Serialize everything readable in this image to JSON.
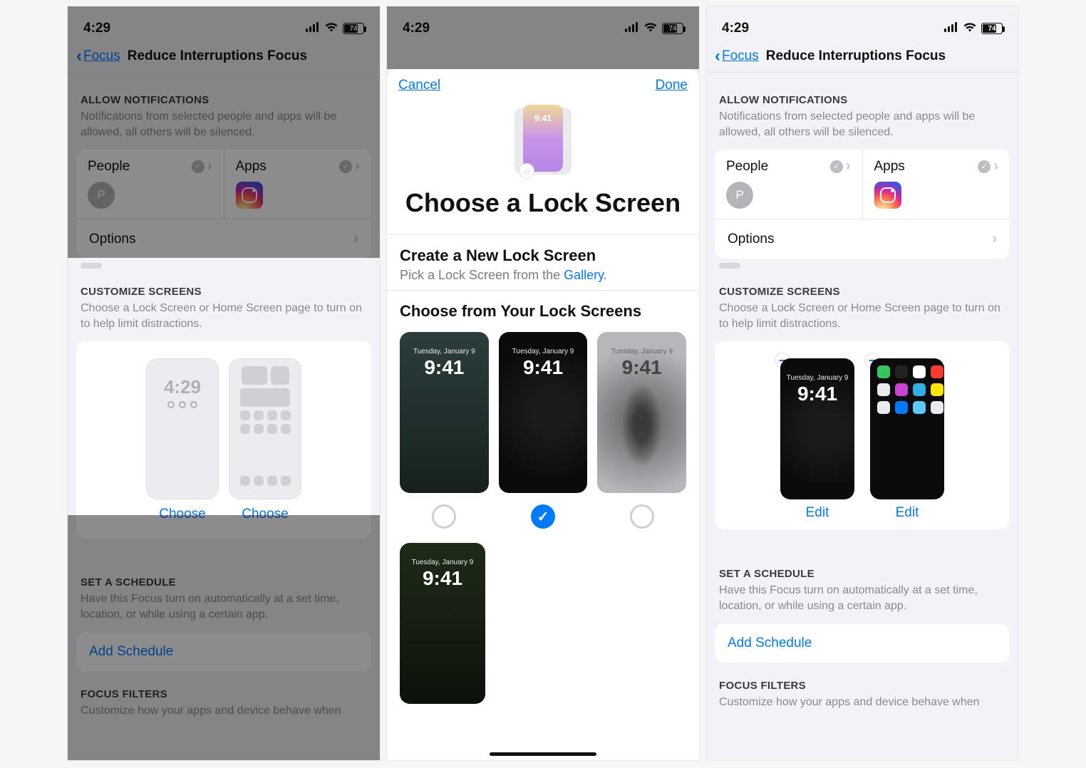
{
  "status": {
    "time": "4:29",
    "battery": "74",
    "batteryFill": "74%"
  },
  "nav": {
    "back": "Focus",
    "title": "Reduce Interruptions Focus"
  },
  "allow": {
    "header": "ALLOW NOTIFICATIONS",
    "sub": "Notifications from selected people and apps will be allowed, all others will be silenced.",
    "people": "People",
    "apps": "Apps",
    "peopleInitial": "P",
    "options": "Options"
  },
  "customize": {
    "header": "CUSTOMIZE SCREENS",
    "sub": "Choose a Lock Screen or Home Screen page to turn on to help limit distractions.",
    "choose": "Choose",
    "lockTime": "4:29",
    "edit": "Edit",
    "thumbTime": "9:41"
  },
  "schedule": {
    "header": "SET A SCHEDULE",
    "sub": "Have this Focus turn on automatically at a set time, location, or while using a certain app.",
    "add": "Add Schedule"
  },
  "filters": {
    "header": "FOCUS FILTERS",
    "subPartial": "Customize how your apps and device behave when"
  },
  "sheet": {
    "cancel": "Cancel",
    "done": "Done",
    "heroTime": "9:41",
    "title": "Choose a Lock Screen",
    "createTitle": "Create a New Lock Screen",
    "createSub": "Pick a Lock Screen from the ",
    "gallery": "Gallery",
    "chooseFrom": "Choose from Your Lock Screens",
    "lsDate": "Tuesday, January 9",
    "lsTime": "9:41"
  }
}
